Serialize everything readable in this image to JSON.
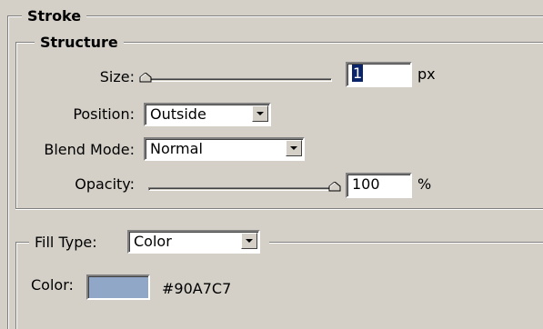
{
  "stroke": {
    "title": "Stroke",
    "structure": {
      "title": "Structure",
      "size": {
        "label": "Size:",
        "value": "1",
        "unit": "px",
        "slider_fraction": 0.0
      },
      "position": {
        "label": "Position:",
        "value": "Outside"
      },
      "blend_mode": {
        "label": "Blend Mode:",
        "value": "Normal"
      },
      "opacity": {
        "label": "Opacity:",
        "value": "100",
        "unit": "%",
        "slider_fraction": 1.0
      }
    },
    "fill": {
      "type_label": "Fill Type:",
      "type_value": "Color",
      "color_label": "Color:",
      "color_hex_text": "#90A7C7",
      "swatch_color": "#90a7c7"
    }
  },
  "colors": {
    "panel_bg": "#d4d0c8",
    "selection": "#0a246a"
  }
}
